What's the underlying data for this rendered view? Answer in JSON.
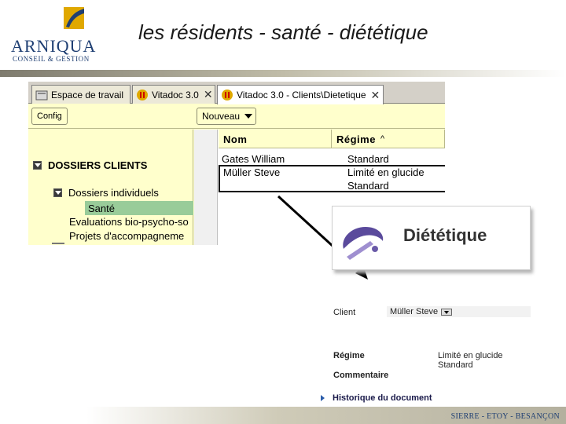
{
  "slide": {
    "title": "les résidents - santé - diététique",
    "logo_word": "ARNIQUA",
    "logo_sub": "CONSEIL & GESTION",
    "footer": "SIERRE - ETOY - BESANÇON"
  },
  "app": {
    "tabs": [
      {
        "label": "Espace de travail",
        "icon": "folder-icon"
      },
      {
        "label": "Vitadoc 3.0",
        "icon": "vitadoc-icon"
      },
      {
        "label": "Vitadoc 3.0 - Clients\\Dietetique",
        "icon": "vitadoc-icon"
      }
    ],
    "toolbar": {
      "config_label": "Config",
      "nouveau_label": "Nouveau"
    },
    "tree": {
      "root": "DOSSIERS CLIENTS",
      "folder": "Dossiers individuels",
      "items": [
        "Santé",
        "Evaluations bio-psycho-so",
        "Projets d'accompagneme"
      ]
    },
    "grid": {
      "columns": [
        "Nom",
        "Régime"
      ],
      "sort_icon": "^",
      "rows": [
        {
          "nom": "Gates William",
          "regime": "Standard"
        },
        {
          "nom": "Müller Steve",
          "regime": "Limité en glucide"
        },
        {
          "nom": "",
          "regime": "Standard"
        }
      ]
    }
  },
  "form": {
    "title": "Diététique",
    "client_label": "Client",
    "client_value": "Müller Steve",
    "regime_label": "Régime",
    "regime_value_1": "Limité en glucide",
    "regime_value_2": "Standard",
    "comment_label": "Commentaire",
    "history_label": "Historique du document"
  },
  "colors": {
    "app_background": "#ffffcc",
    "tree_selected": "#99cc99",
    "brand_blue": "#1f3f73",
    "brand_gold": "#e0a800"
  }
}
